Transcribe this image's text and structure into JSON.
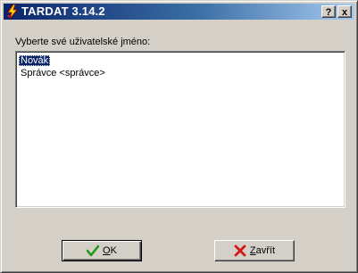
{
  "window": {
    "title": "TARDAT 3.14.2",
    "help_label": "?",
    "close_label": "x"
  },
  "dialog": {
    "prompt": "Vyberte své uživatelské jméno:",
    "users": [
      {
        "label": "Novák",
        "selected": true
      },
      {
        "label": "Správce <správce>",
        "selected": false
      }
    ],
    "ok_label": "OK",
    "close_label": "Zavřít"
  },
  "colors": {
    "title_gradient_start": "#0a246a",
    "title_gradient_end": "#a6caf0",
    "face": "#d4d0c8",
    "selection": "#0a246a",
    "ok_check": "#1f9a1f",
    "close_x": "#d01818"
  },
  "icons": {
    "app": "lightning-icon",
    "ok": "checkmark-icon",
    "close": "red-x-icon"
  }
}
